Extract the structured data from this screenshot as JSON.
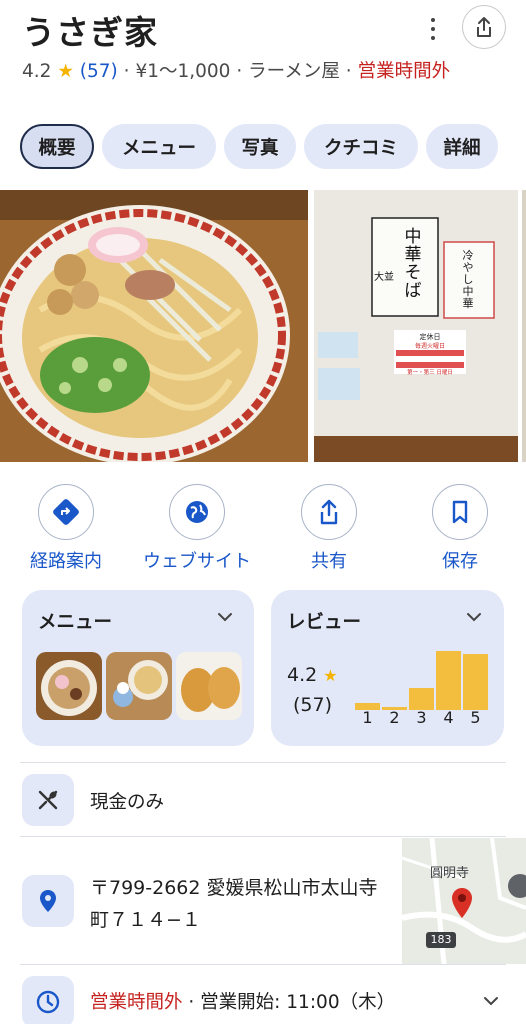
{
  "header": {
    "title": "うさぎ家",
    "rating": "4.2",
    "review_count": "(57)",
    "price": "¥1～1,000",
    "category": "ラーメン屋",
    "status": "営業時間外"
  },
  "tabs": [
    {
      "label": "概要"
    },
    {
      "label": "メニュー"
    },
    {
      "label": "写真"
    },
    {
      "label": "クチコミ"
    },
    {
      "label": "詳細"
    }
  ],
  "photo_text": {
    "sign_main": "中華そば",
    "sign_size": "大並",
    "sign_cold": "冷やし中華",
    "notice_title": "定休日",
    "notice_line1": "毎週火曜日",
    "notice_line2": "第一・第三 日曜日"
  },
  "actions": [
    {
      "label": "経路案内",
      "icon": "directions-icon"
    },
    {
      "label": "ウェブサイト",
      "icon": "globe-icon"
    },
    {
      "label": "共有",
      "icon": "share-icon"
    },
    {
      "label": "保存",
      "icon": "bookmark-icon"
    }
  ],
  "menu_card": {
    "title": "メニュー"
  },
  "review_card": {
    "title": "レビュー",
    "rating": "4.2",
    "count": "(57)",
    "distribution": [
      {
        "stars": "1",
        "share": 0.09
      },
      {
        "stars": "2",
        "share": 0.04
      },
      {
        "stars": "3",
        "share": 0.28
      },
      {
        "stars": "4",
        "share": 0.75
      },
      {
        "stars": "5",
        "share": 0.72
      }
    ]
  },
  "payment": {
    "label": "現金のみ"
  },
  "address": {
    "text": "〒799-2662 愛媛県松山市太山寺町７１４−１"
  },
  "map": {
    "place_label": "圓明寺",
    "route_label": "183"
  },
  "hours": {
    "status": "営業時間外",
    "separator": " · ",
    "next_open": "営業開始: 11:00（木）"
  },
  "colors": {
    "accent_blue": "#1a57c9",
    "closed_red": "#c5221f",
    "star": "#f5b400",
    "chip_bg": "#e3e8f8"
  }
}
